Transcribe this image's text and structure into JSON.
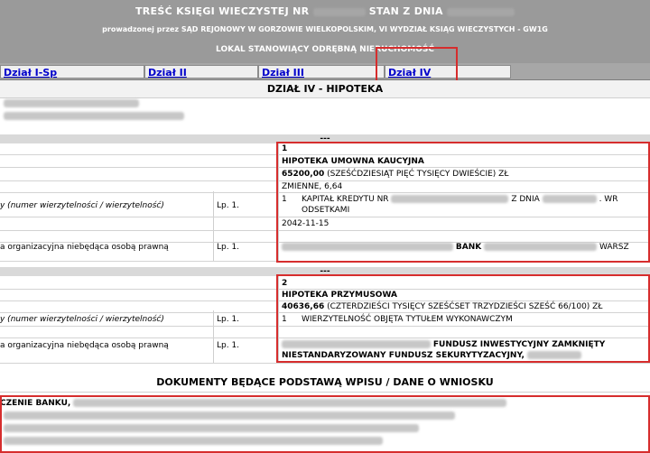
{
  "header": {
    "line1_prefix": "TREŚĆ KSIĘGI WIECZYSTEJ NR",
    "line1_mid": "STAN Z DNIA",
    "line2": "prowadzonej przez SĄD REJONOWY W GORZOWIE WIELKOPOLSKIM, VI WYDZIAŁ KSIĄG WIECZYSTYCH - GW1G",
    "line3": "LOKAL STANOWIĄCY ODRĘBNĄ NIERUCHOMOŚĆ"
  },
  "tabs": [
    {
      "label": "Dział I-Sp"
    },
    {
      "label": "Dział II"
    },
    {
      "label": "Dział III"
    },
    {
      "label": "Dział IV"
    }
  ],
  "section_title": "DZIAŁ IV - HIPOTEKA",
  "separator": "---",
  "labels": {
    "claims": "y (numer wierzytelności / wierzytelność)",
    "org": "a organizacyjna niebędąca osobą prawną",
    "lp": "Lp. 1."
  },
  "mortgages": [
    {
      "number": "1",
      "type": "HIPOTEKA UMOWNA KAUCYJNA",
      "amount": "65200,00",
      "amount_words": "(SZEŚĆDZIESIĄT PIĘĆ TYSIĘCY DWIEŚCIE) ZŁ",
      "interest": "ZMIENNE, 6,64",
      "claim_no": "1",
      "claim_text_a": "KAPITAŁ KREDYTU NR",
      "claim_text_b": "Z DNIA",
      "claim_text_c": ". WR",
      "claim_text_d": "ODSETKAMI",
      "date": "2042-11-15",
      "creditor_a": "BANK",
      "creditor_b": "WARSZ"
    },
    {
      "number": "2",
      "type": "HIPOTEKA PRZYMUSOWA",
      "amount": "40636,66",
      "amount_words": "(CZTERDZIEŚCI TYSIĘCY SZEŚĆSET TRZYDZIEŚCI SZEŚĆ 66/100) ZŁ",
      "claim_no": "1",
      "claim_text": "WIERZYTELNOŚĆ OBJĘTA TYTUŁEM WYKONAWCZYM",
      "creditor_a": "FUNDUSZ INWESTYCYJNY ZAMKNIĘTY",
      "creditor_b": "NIESTANDARYZOWANY FUNDUSZ SEKURYTYZACYJNY,"
    }
  ],
  "documents": {
    "title": "DOKUMENTY BĘDĄCE PODSTAWĄ WPISU / DANE O WNIOSKU",
    "first_line": "CZENIE BANKU,"
  },
  "colors": {
    "header_bg": "#9a9a9a",
    "highlight": "#d62d2d",
    "link": "#0000cc"
  }
}
